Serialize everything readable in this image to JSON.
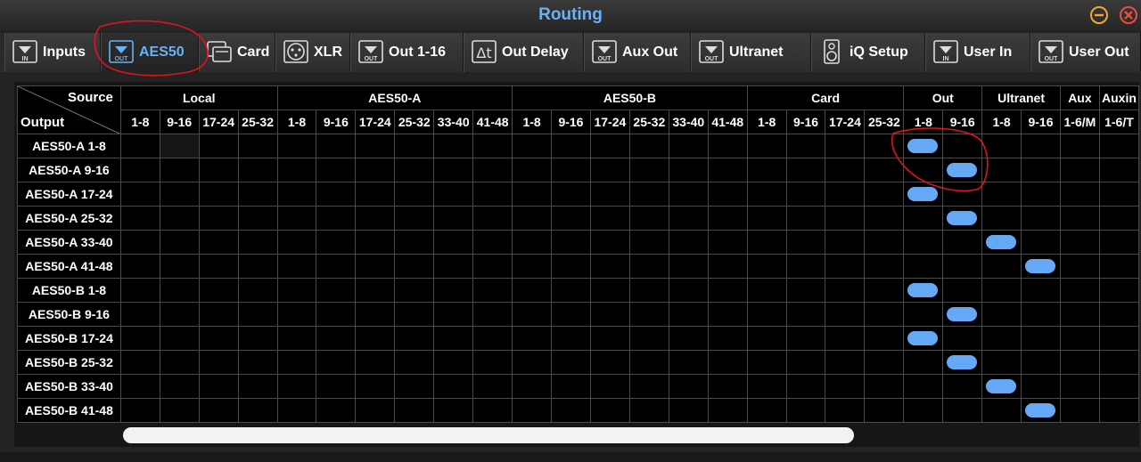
{
  "window": {
    "title": "Routing",
    "minimize_icon": "minimize-circle-icon",
    "close_icon": "close-circle-icon",
    "accent_color": "#f0a830"
  },
  "tabs": [
    {
      "label": "Inputs",
      "icon": "in-arrow-icon",
      "active": false
    },
    {
      "label": "AES50",
      "icon": "out-arrow-icon",
      "active": true
    },
    {
      "label": "Card",
      "icon": "card-icon",
      "active": false
    },
    {
      "label": "XLR",
      "icon": "xlr-icon",
      "active": false
    },
    {
      "label": "Out 1-16",
      "icon": "out-arrow-icon",
      "active": false
    },
    {
      "label": "Out Delay",
      "icon": "delta-t-icon",
      "active": false
    },
    {
      "label": "Aux Out",
      "icon": "out-arrow-icon",
      "active": false
    },
    {
      "label": "Ultranet",
      "icon": "out-arrow-icon",
      "active": false
    },
    {
      "label": "iQ Setup",
      "icon": "speaker-icon",
      "active": false
    },
    {
      "label": "User In",
      "icon": "in-arrow-icon",
      "active": false
    },
    {
      "label": "User Out",
      "icon": "out-arrow-icon",
      "active": false
    }
  ],
  "matrix": {
    "corner_source": "Source",
    "corner_output": "Output",
    "groups": [
      {
        "label": "Local",
        "subs": [
          "1-8",
          "9-16",
          "17-24",
          "25-32"
        ]
      },
      {
        "label": "AES50-A",
        "subs": [
          "1-8",
          "9-16",
          "17-24",
          "25-32",
          "33-40",
          "41-48"
        ]
      },
      {
        "label": "AES50-B",
        "subs": [
          "1-8",
          "9-16",
          "17-24",
          "25-32",
          "33-40",
          "41-48"
        ]
      },
      {
        "label": "Card",
        "subs": [
          "1-8",
          "9-16",
          "17-24",
          "25-32"
        ]
      },
      {
        "label": "Out",
        "subs": [
          "1-8",
          "9-16"
        ]
      },
      {
        "label": "Ultranet",
        "subs": [
          "1-8",
          "9-16"
        ]
      },
      {
        "label": "Aux",
        "subs": [
          "1-6/M"
        ]
      },
      {
        "label": "Auxin",
        "subs": [
          "1-6/T"
        ]
      }
    ],
    "rows": [
      {
        "label": "AES50-A 1-8",
        "selected": "Out 1-8"
      },
      {
        "label": "AES50-A 9-16",
        "selected": "Out 9-16"
      },
      {
        "label": "AES50-A 17-24",
        "selected": "Out 1-8"
      },
      {
        "label": "AES50-A 25-32",
        "selected": "Out 9-16"
      },
      {
        "label": "AES50-A 33-40",
        "selected": "Ultranet 1-8"
      },
      {
        "label": "AES50-A 41-48",
        "selected": "Ultranet 9-16"
      },
      {
        "label": "AES50-B 1-8",
        "selected": "Out 1-8"
      },
      {
        "label": "AES50-B 9-16",
        "selected": "Out 9-16"
      },
      {
        "label": "AES50-B 17-24",
        "selected": "Out 1-8"
      },
      {
        "label": "AES50-B 25-32",
        "selected": "Out 9-16"
      },
      {
        "label": "AES50-B 33-40",
        "selected": "Ultranet 1-8"
      },
      {
        "label": "AES50-B 41-48",
        "selected": "Ultranet 9-16"
      }
    ],
    "selected_color": "#65a8f5",
    "disabled_cell": {
      "row": "AES50-A 1-8",
      "column": "Local 9-16"
    }
  },
  "annotation_color": "#e0141e"
}
